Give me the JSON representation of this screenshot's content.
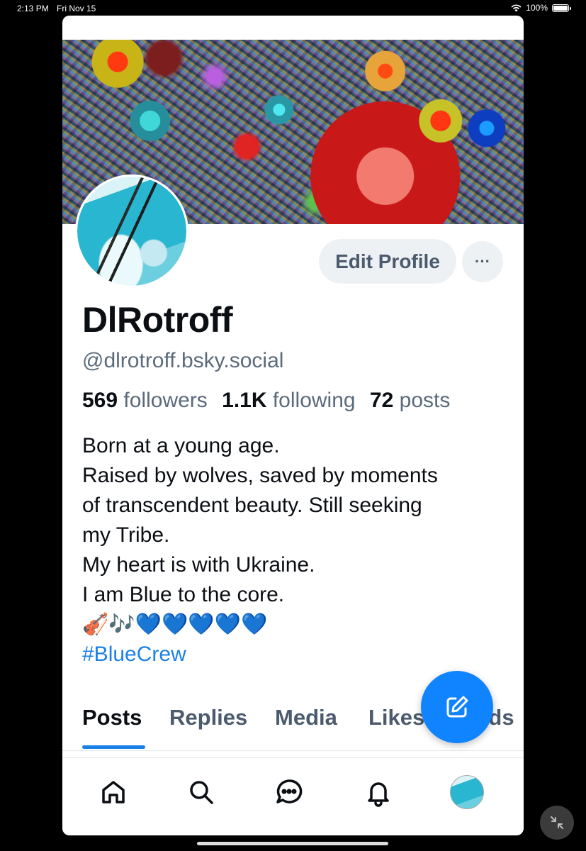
{
  "status_bar": {
    "time": "2:13 PM",
    "date": "Fri Nov 15",
    "battery": "100%"
  },
  "profile": {
    "edit_label": "Edit Profile",
    "more_label": "···",
    "display_name": "DlRotroff",
    "handle": "@dlrotroff.bsky.social",
    "stats": {
      "followers_count": "569",
      "followers_label": "followers",
      "following_count": "1.1K",
      "following_label": "following",
      "posts_count": "72",
      "posts_label": "posts"
    },
    "bio_lines": [
      "Born at a young age.",
      "Raised by wolves, saved by moments",
      "of transcendent beauty. Still seeking",
      "my Tribe.",
      "My heart is with Ukraine.",
      "I am Blue to the core.",
      "🎻🎶💙💙💙💙💙"
    ],
    "hashtag": "#BlueCrew"
  },
  "tabs": [
    "Posts",
    "Replies",
    "Media",
    "Likes",
    "Feeds"
  ],
  "active_tab": "Posts",
  "colors": {
    "accent": "#1083fe",
    "link": "#1b80e8",
    "muted": "#5b6b7c"
  },
  "nav": [
    "home-icon",
    "search-icon",
    "chat-icon",
    "bell-icon",
    "profile-avatar"
  ]
}
